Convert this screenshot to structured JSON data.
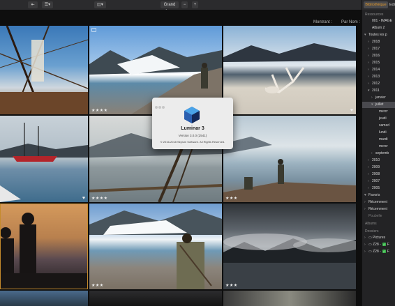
{
  "toolbar": {
    "view_label": "Grand for...",
    "buttons": [
      "tb-left",
      "tb-list",
      "tb-view",
      "tb-minus",
      "tb-plus"
    ]
  },
  "sortbar": {
    "sort_by": "Montrant :",
    "sort_order": "Par Nom :"
  },
  "sidebar": {
    "tabs": [
      "Bibliothèque",
      "Edi"
    ],
    "sources_title": "Ressources",
    "rows": [
      {
        "label": "001 - IMAGE",
        "depth": 1,
        "chev": ""
      },
      {
        "label": "Album 2",
        "depth": 1,
        "chev": ""
      },
      {
        "label": "Toutes les p",
        "depth": 0,
        "chev": "▾"
      },
      {
        "label": "2018",
        "depth": 1,
        "chev": "›"
      },
      {
        "label": "2017",
        "depth": 1,
        "chev": "›"
      },
      {
        "label": "2016",
        "depth": 1,
        "chev": "›"
      },
      {
        "label": "2015",
        "depth": 1,
        "chev": "›"
      },
      {
        "label": "2014",
        "depth": 1,
        "chev": "›"
      },
      {
        "label": "2013",
        "depth": 1,
        "chev": "›"
      },
      {
        "label": "2012",
        "depth": 1,
        "chev": "›"
      },
      {
        "label": "2011",
        "depth": 1,
        "chev": "▾"
      },
      {
        "label": "janvier",
        "depth": 2,
        "chev": "›"
      },
      {
        "label": "juillet",
        "depth": 2,
        "chev": "▾",
        "selected": true
      },
      {
        "label": "mercr",
        "depth": 3,
        "chev": ""
      },
      {
        "label": "jeudi",
        "depth": 3,
        "chev": ""
      },
      {
        "label": "samed",
        "depth": 3,
        "chev": ""
      },
      {
        "label": "lundi",
        "depth": 3,
        "chev": ""
      },
      {
        "label": "mardi",
        "depth": 3,
        "chev": ""
      },
      {
        "label": "mercr",
        "depth": 3,
        "chev": ""
      },
      {
        "label": "septemb",
        "depth": 2,
        "chev": "›"
      },
      {
        "label": "2010",
        "depth": 1,
        "chev": "›"
      },
      {
        "label": "2009",
        "depth": 1,
        "chev": "›"
      },
      {
        "label": "2008",
        "depth": 1,
        "chev": "›"
      },
      {
        "label": "2007",
        "depth": 1,
        "chev": "›"
      },
      {
        "label": "2005",
        "depth": 1,
        "chev": "›"
      },
      {
        "label": "Favoris",
        "depth": 0,
        "chev": "♥"
      },
      {
        "label": "Récemment",
        "depth": 0,
        "chev": "›"
      },
      {
        "label": "Récemment",
        "depth": 0,
        "chev": "›"
      },
      {
        "label": "Poubelle",
        "depth": 0,
        "chev": "",
        "dim": true
      }
    ],
    "albums_title": "Albums",
    "folders_title": "Dossiers",
    "folders": [
      {
        "label": "Pictures",
        "check": false
      },
      {
        "label": "Z28 -",
        "check": true,
        "extra": "F"
      },
      {
        "label": "Z28 -",
        "check": true,
        "extra": "F"
      }
    ]
  },
  "photos": [
    {
      "name": "ship-rigging",
      "rating": "",
      "heart": false
    },
    {
      "name": "glacier-photographer",
      "rating": "★★★★",
      "heart": false
    },
    {
      "name": "reindeer-antlers",
      "rating": "★★",
      "heart": true
    },
    {
      "name": "red-sailboat",
      "rating": "",
      "heart": true
    },
    {
      "name": "ship-rope-fog",
      "rating": "★★★★",
      "heart": false
    },
    {
      "name": "hikers-fjord",
      "rating": "★★★",
      "heart": false
    },
    {
      "name": "silhouettes",
      "rating": "",
      "heart": false
    },
    {
      "name": "glacier-man",
      "rating": "★★★",
      "heart": false
    },
    {
      "name": "misty-mountains",
      "rating": "★★★",
      "heart": false
    }
  ],
  "dialog": {
    "app_name": "Luminar 3",
    "version": "Version 3.0.0 (2541)",
    "copyright": "© 2016-2018 Skylum Software. All Rights Reserved."
  }
}
